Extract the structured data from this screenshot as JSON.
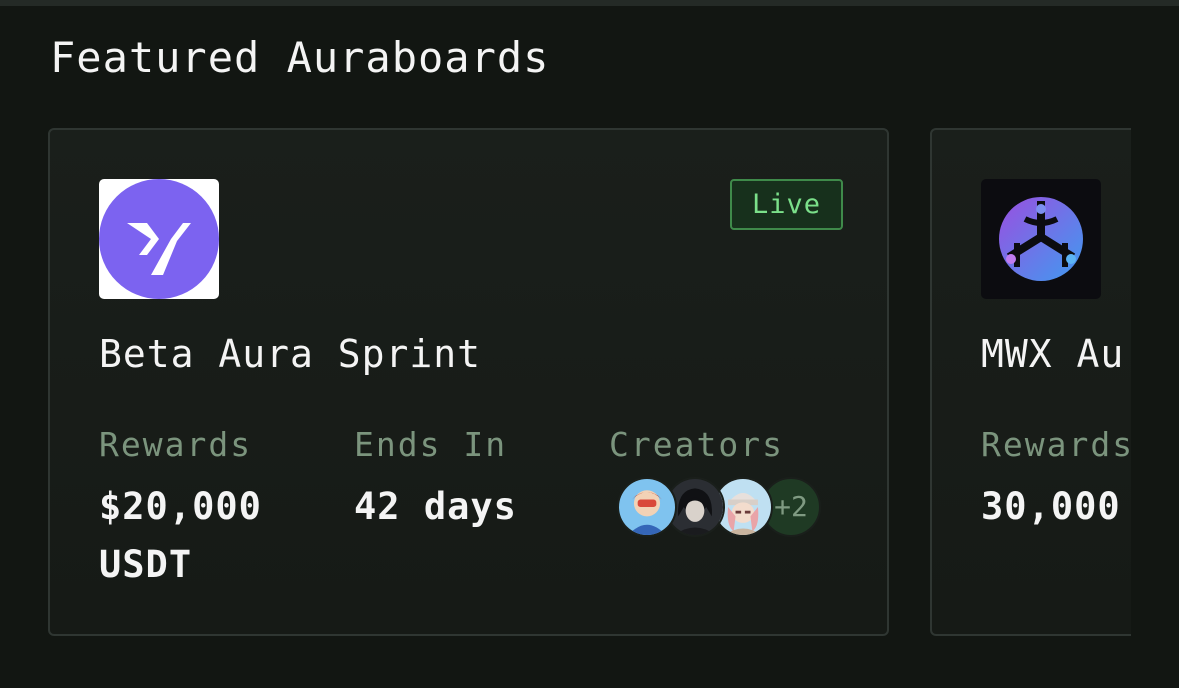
{
  "section": {
    "title": "Featured Auraboards"
  },
  "cards": [
    {
      "title": "Beta Aura Sprint",
      "status": "Live",
      "logo_icon": "purple-circle-slash-logo-icon",
      "rewards_label": "Rewards",
      "rewards_value": "$20,000 USDT",
      "ends_label": "Ends In",
      "ends_value": "42 days",
      "creators_label": "Creators",
      "creators_extra": "+2",
      "creator_avatars": [
        "anime-fox-mask-avatar",
        "dark-hair-anime-avatar",
        "pink-hair-beanie-avatar"
      ]
    },
    {
      "title": "MWX Au",
      "logo_icon": "blue-purple-cube-logo-icon",
      "rewards_label": "Rewards",
      "rewards_value": "30,000"
    }
  ],
  "colors": {
    "background": "#121612",
    "card_border": "#2f3632",
    "label": "#7b947d",
    "live_text": "#7be08a",
    "live_border": "#3f8a4a",
    "logo_purple": "#7c63f0"
  }
}
